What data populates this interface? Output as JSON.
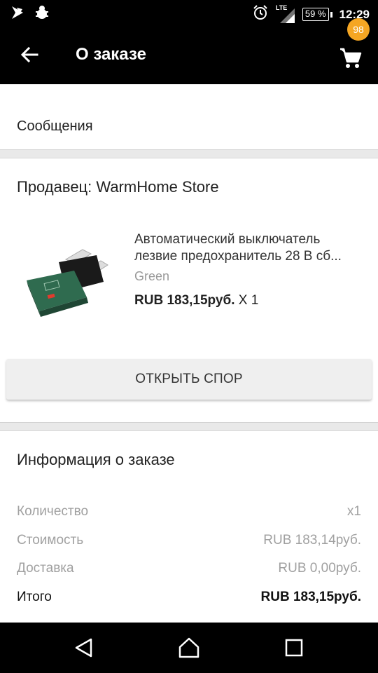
{
  "status_bar": {
    "network": "LTE",
    "battery": "59 %",
    "time": "12:29",
    "icons": [
      "signal-app-icon",
      "android-debug-icon",
      "alarm-icon",
      "lte-signal-icon",
      "battery-icon"
    ]
  },
  "app_bar": {
    "title": "О заказе",
    "cart_count": "98",
    "icons": [
      "back-arrow-icon",
      "cart-icon"
    ]
  },
  "messages": {
    "label": "Сообщения"
  },
  "seller": {
    "label": "Продавец: WarmHome Store"
  },
  "product": {
    "title_line1": "Автоматический выключатель",
    "title_line2": "лезвие предохранитель 28 В сб...",
    "variant": "Green",
    "price": "RUB 183,15руб.",
    "quantity": " X 1",
    "image_color": "#2f6b4f"
  },
  "dispute_button": {
    "label": "ОТКРЫТЬ СПОР"
  },
  "order_info": {
    "title": "Информация о заказе",
    "rows": [
      {
        "label": "Количество",
        "value": "x1"
      },
      {
        "label": "Стоимость",
        "value": "RUB 183,14руб."
      },
      {
        "label": "Доставка",
        "value": "RUB 0,00руб."
      },
      {
        "label": "Итого",
        "value": "RUB 183,15руб."
      }
    ]
  },
  "nav_bar": {
    "icons": [
      "nav-back-icon",
      "nav-home-icon",
      "nav-recents-icon"
    ]
  },
  "colors": {
    "app_bar": "#000000",
    "badge": "#f5a623",
    "background": "#e9e9e9",
    "muted_text": "#a0a0a0"
  }
}
